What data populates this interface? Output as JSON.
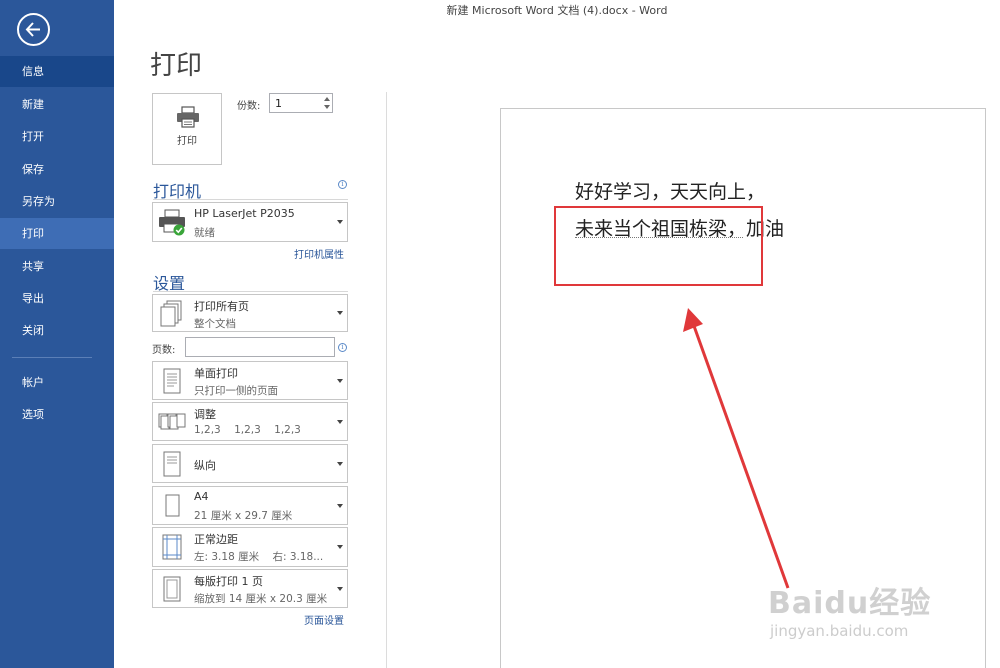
{
  "window": {
    "title": "新建 Microsoft Word 文档 (4).docx - Word"
  },
  "sidebar": {
    "items": [
      {
        "label": "信息"
      },
      {
        "label": "新建"
      },
      {
        "label": "打开"
      },
      {
        "label": "保存"
      },
      {
        "label": "另存为"
      },
      {
        "label": "打印"
      },
      {
        "label": "共享"
      },
      {
        "label": "导出"
      },
      {
        "label": "关闭"
      },
      {
        "label": "帐户"
      },
      {
        "label": "选项"
      }
    ],
    "active_item": "打印",
    "colors": {
      "background": "#2b579a",
      "active": "#3e6db5"
    }
  },
  "print": {
    "title": "打印",
    "print_button": "打印",
    "copies_label": "份数:",
    "copies_value": "1"
  },
  "printer": {
    "heading": "打印机",
    "name": "HP LaserJet P2035",
    "status": "就绪",
    "properties_link": "打印机属性"
  },
  "settings": {
    "heading": "设置",
    "range": {
      "line1": "打印所有页",
      "line2": "整个文档"
    },
    "pages_label": "页数:",
    "pages_value": "",
    "sides": {
      "line1": "单面打印",
      "line2": "只打印一侧的页面"
    },
    "collate": {
      "line1": "调整",
      "line2": "1,2,3    1,2,3    1,2,3"
    },
    "orientation": {
      "line1": "纵向"
    },
    "paper": {
      "line1": "A4",
      "line2": "21 厘米 x 29.7 厘米"
    },
    "margins": {
      "line1": "正常边距",
      "line2": "左: 3.18 厘米    右: 3.18..."
    },
    "per_sheet": {
      "line1": "每版打印 1 页",
      "line2": "缩放到 14 厘米 x 20.3 厘米"
    },
    "page_setup_link": "页面设置"
  },
  "preview": {
    "lines": [
      "好好学习，天天向上，",
      "未来当个祖国栋梁，加油"
    ],
    "annotation_color": "#e0383a"
  },
  "watermark": {
    "logo": "Baidu经验",
    "url": "jingyan.baidu.com"
  }
}
